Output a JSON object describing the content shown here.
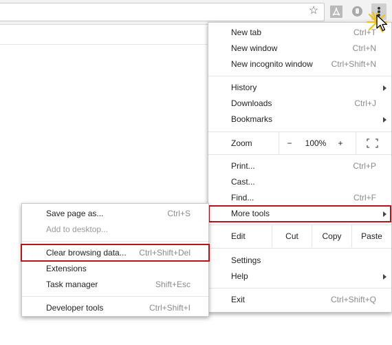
{
  "main_menu": {
    "items": [
      {
        "label": "New tab",
        "shortcut": "Ctrl+T"
      },
      {
        "label": "New window",
        "shortcut": "Ctrl+N"
      },
      {
        "label": "New incognito window",
        "shortcut": "Ctrl+Shift+N"
      },
      {
        "label": "History",
        "shortcut": ""
      },
      {
        "label": "Downloads",
        "shortcut": "Ctrl+J"
      },
      {
        "label": "Bookmarks",
        "shortcut": ""
      },
      {
        "label": "Print...",
        "shortcut": "Ctrl+P"
      },
      {
        "label": "Cast...",
        "shortcut": ""
      },
      {
        "label": "Find...",
        "shortcut": "Ctrl+F"
      },
      {
        "label": "More tools",
        "shortcut": ""
      },
      {
        "label": "Settings",
        "shortcut": ""
      },
      {
        "label": "Help",
        "shortcut": ""
      },
      {
        "label": "Exit",
        "shortcut": "Ctrl+Shift+Q"
      }
    ],
    "zoom": {
      "label": "Zoom",
      "minus": "−",
      "value": "100%",
      "plus": "+"
    },
    "edit": {
      "label": "Edit",
      "cut": "Cut",
      "copy": "Copy",
      "paste": "Paste"
    }
  },
  "sub_menu": {
    "items": [
      {
        "label": "Save page as...",
        "shortcut": "Ctrl+S",
        "enabled": true
      },
      {
        "label": "Add to desktop...",
        "shortcut": "",
        "enabled": false
      },
      {
        "label": "Clear browsing data...",
        "shortcut": "Ctrl+Shift+Del",
        "enabled": true
      },
      {
        "label": "Extensions",
        "shortcut": "",
        "enabled": true
      },
      {
        "label": "Task manager",
        "shortcut": "Shift+Esc",
        "enabled": true
      },
      {
        "label": "Developer tools",
        "shortcut": "Ctrl+Shift+I",
        "enabled": true
      }
    ]
  },
  "colors": {
    "highlight": "#b3151b",
    "burst": "#f5c400"
  }
}
